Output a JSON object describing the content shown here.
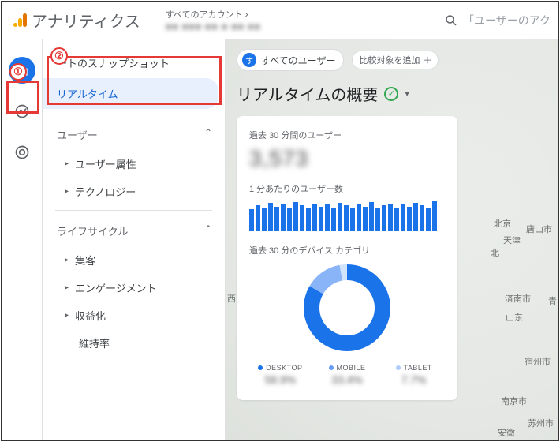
{
  "brand": "アナリティクス",
  "account_label": "すべてのアカウント",
  "account_detail_blur": "■■ ■■■ ■■ ■ ■■  ■■",
  "search_placeholder": "「ユーザーのアク",
  "annotations": {
    "one": "①",
    "two": "②"
  },
  "nav": {
    "snapshot": "ートのスナップショット",
    "realtime": "リアルタイム",
    "section_user": "ユーザー",
    "user_attr": "ユーザー属性",
    "technology": "テクノロジー",
    "section_lifecycle": "ライフサイクル",
    "acquisition": "集客",
    "engagement": "エンゲージメント",
    "monetization": "収益化",
    "retention": "維持率"
  },
  "chip_all_users": "すべてのユーザー",
  "chip_badge": "す",
  "chip_compare": "比較対象を追加",
  "page_title": "リアルタイムの概要",
  "card": {
    "users_30min_label": "過去 30 分間のユーザー",
    "users_blur": "3,573",
    "per_min_label": "1 分あたりのユーザー数",
    "device_30min_label": "過去 30 分のデバイス カテゴリ",
    "legend": {
      "desktop": "DESKTOP",
      "desktop_val": "58.9%",
      "mobile": "MOBILE",
      "mobile_val": "33.4%",
      "tablet": "TABLET",
      "tablet_val": "7.7%"
    }
  },
  "map_labels": {
    "beijing": "北京",
    "tangshan": "唐山市",
    "tianjin": "天津",
    "jinan": "済南市",
    "qing": "青",
    "shandong": "山东",
    "nanjing": "南京市",
    "suzhou1": "苏州市",
    "anhui": "安徽",
    "suzhou2": "宿州市",
    "beixian": "北",
    "xi": "西"
  },
  "chart_data": {
    "type": "bar",
    "title": "1 分あたりのユーザー数",
    "categories_count": 30,
    "values": [
      26,
      30,
      28,
      33,
      29,
      31,
      27,
      34,
      30,
      28,
      32,
      29,
      31,
      27,
      33,
      30,
      28,
      31,
      29,
      34,
      27,
      30,
      32,
      28,
      31,
      29,
      33,
      30,
      28,
      35
    ],
    "ylim": [
      0,
      40
    ]
  }
}
